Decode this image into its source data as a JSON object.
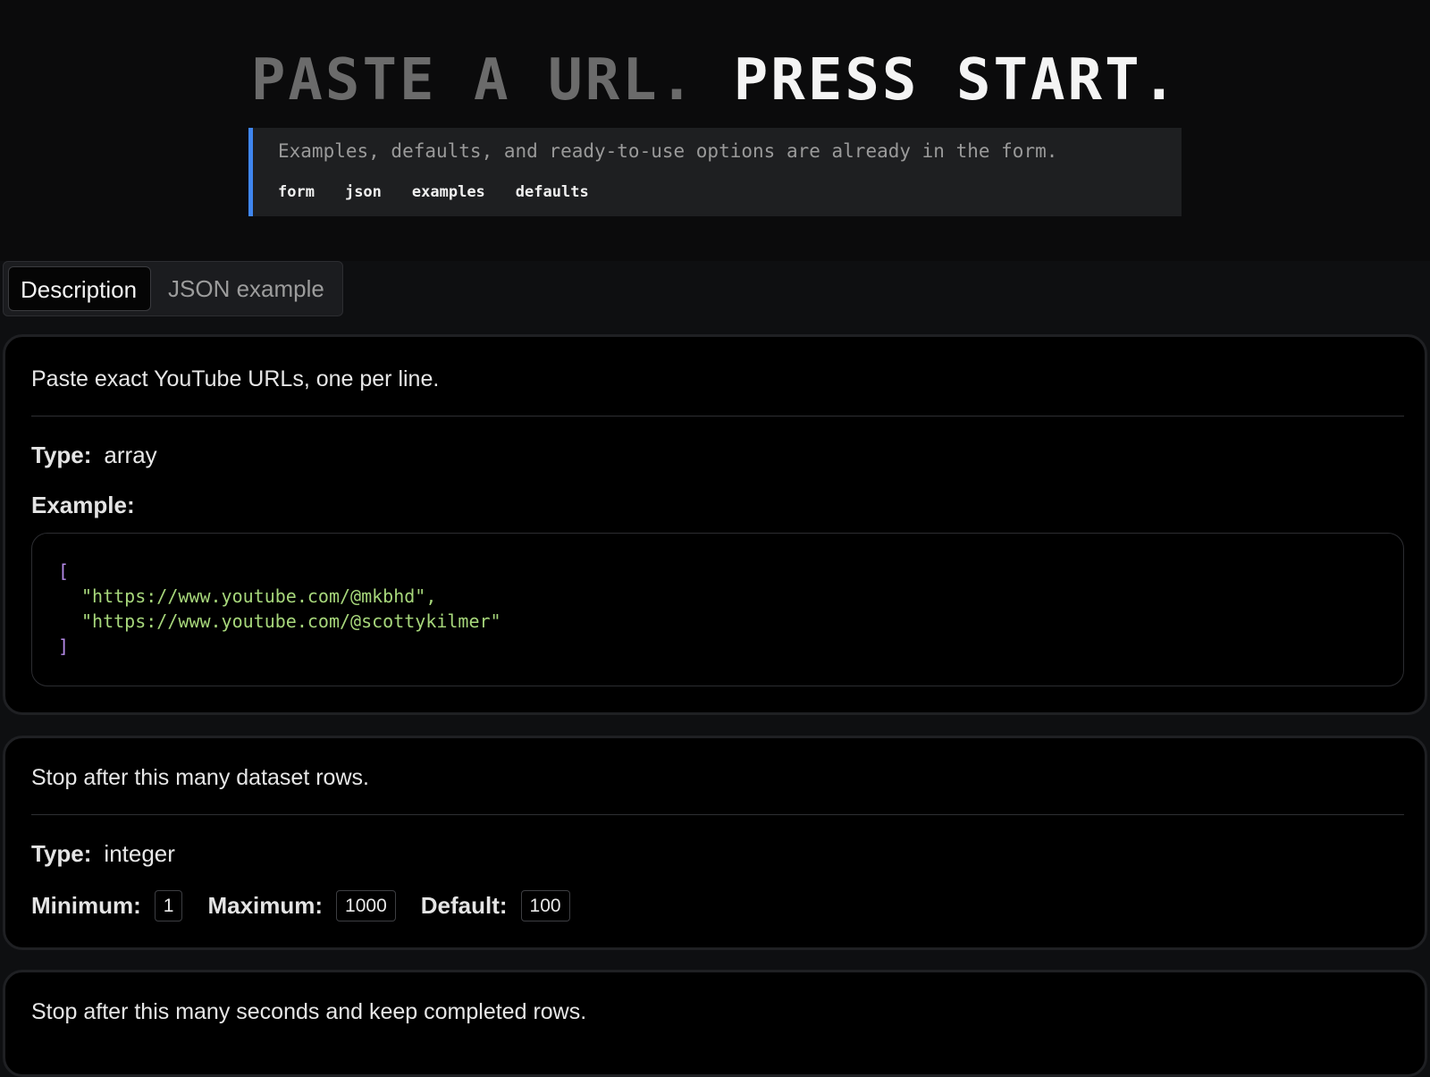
{
  "hero": {
    "headline_dim": "PASTE A URL.",
    "headline_bright": "PRESS START.",
    "callout_text": "Examples, defaults, and ready-to-use options are already in the form.",
    "tags": [
      "form",
      "json",
      "examples",
      "defaults"
    ],
    "accent_color": "#3f86f0"
  },
  "tabs": {
    "active": "Description",
    "inactive": "JSON example"
  },
  "fields": [
    {
      "description": "Paste exact YouTube URLs, one per line.",
      "type_label": "Type:",
      "type_value": "array",
      "example_label": "Example:",
      "example_open": "[",
      "example_lines": [
        "\"https://www.youtube.com/@mkbhd\",",
        "\"https://www.youtube.com/@scottykilmer\""
      ],
      "example_close": "]"
    },
    {
      "description": "Stop after this many dataset rows.",
      "type_label": "Type:",
      "type_value": "integer",
      "minimum_label": "Minimum:",
      "minimum_value": "1",
      "maximum_label": "Maximum:",
      "maximum_value": "1000",
      "default_label": "Default:",
      "default_value": "100"
    },
    {
      "description": "Stop after this many seconds and keep completed rows."
    }
  ]
}
